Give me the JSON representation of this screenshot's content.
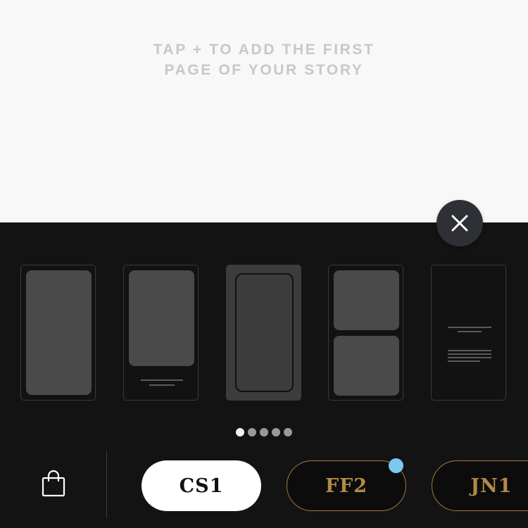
{
  "canvas": {
    "hint_line1": "TAP + TO ADD THE FIRST",
    "hint_line2": "PAGE OF YOUR STORY"
  },
  "close": {
    "icon": "close-icon"
  },
  "templates": [
    {
      "name": "full-image",
      "selected": false
    },
    {
      "name": "image-with-caption",
      "selected": false
    },
    {
      "name": "framed-image",
      "selected": true
    },
    {
      "name": "two-images",
      "selected": false
    },
    {
      "name": "text-only",
      "selected": false
    }
  ],
  "pagination": {
    "total": 5,
    "current": 1
  },
  "bottom_bar": {
    "shop_icon": "shopping-bag-icon",
    "filters": [
      {
        "label": "CS1",
        "active": true
      },
      {
        "label": "FF2",
        "active": false,
        "has_new": true
      },
      {
        "label": "JN1",
        "active": false
      }
    ]
  },
  "colors": {
    "panel_bg": "#131313",
    "accent_gold": "#b08a48",
    "new_badge": "#7cc8f0",
    "hint_text": "#c8c8c8"
  }
}
